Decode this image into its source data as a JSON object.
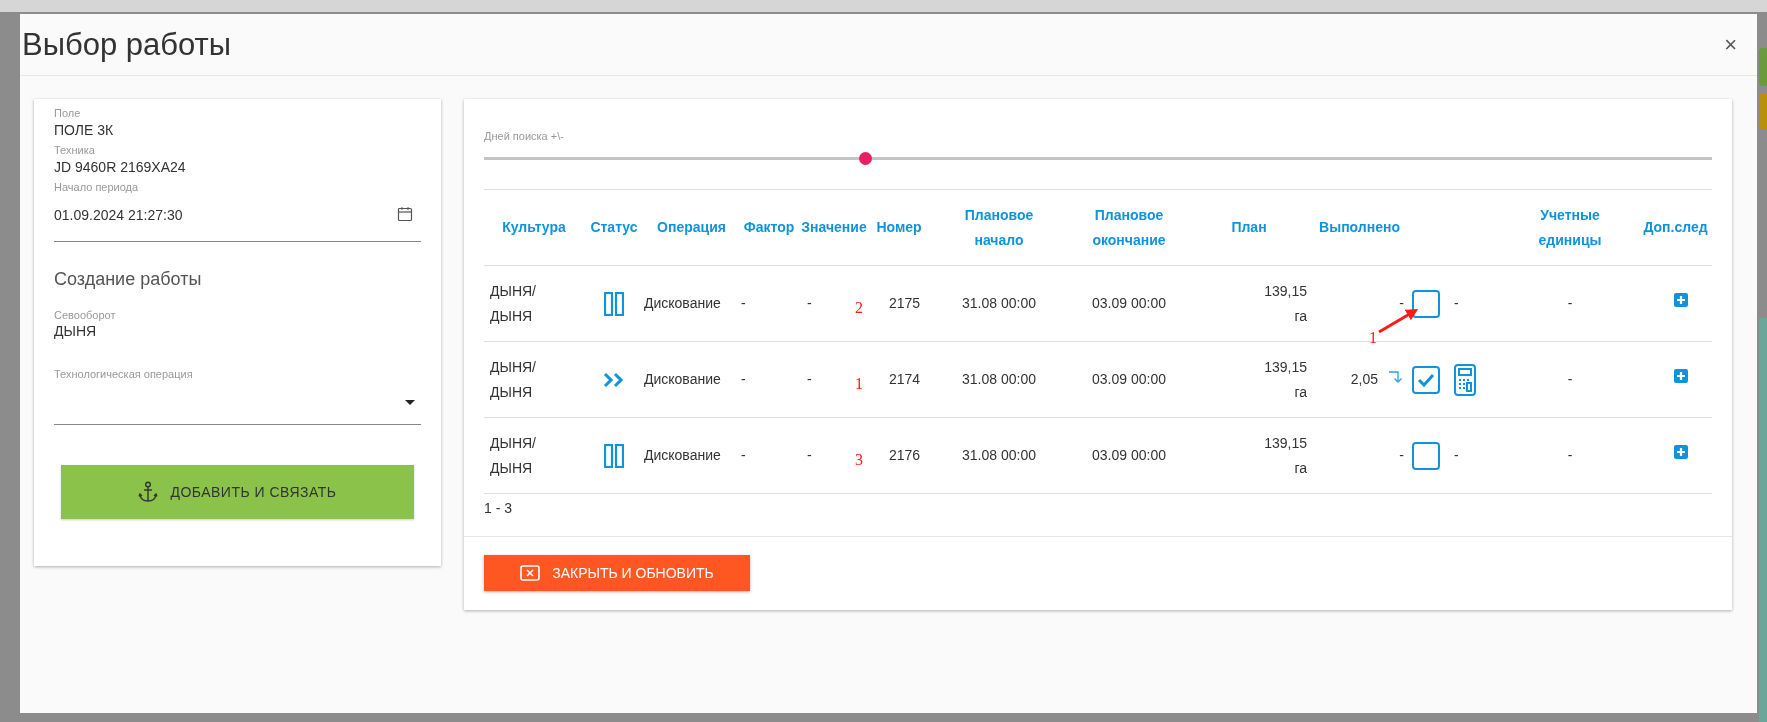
{
  "window": {
    "title": "Выбор работы",
    "close": "×"
  },
  "left_panel": {
    "fields": [
      {
        "label": "Поле",
        "value": "ПОЛЕ 3К"
      },
      {
        "label": "Техника",
        "value": "JD 9460R 2169ХА24"
      }
    ],
    "period": {
      "label": "Начало периода",
      "value": "01.09.2024 21:27:30"
    },
    "section_title": "Создание работы",
    "rotation": {
      "label": "Севооборот",
      "value": "ДЫНЯ"
    },
    "operation": {
      "label": "Технологическая операция"
    },
    "add_button": "ДОБАВИТЬ И СВЯЗАТЬ"
  },
  "slider": {
    "label": "Дней поиска +\\-",
    "level": 0.31
  },
  "table": {
    "columns": [
      "Культура",
      "Статус",
      "Операция",
      "Фактор",
      "Значение",
      "Номер",
      "Плановое начало",
      "Плановое окончание",
      "План",
      "Выполнено",
      "",
      "Учетные единицы",
      "Доп.след"
    ],
    "rows": [
      {
        "culture": "ДЫНЯ/ДЫНЯ",
        "kind": "paused",
        "operation": "Дискование",
        "factor": "-",
        "value": "-",
        "annotation": "2",
        "number": "2175",
        "start": "31.08 00:00",
        "end": "03.09 00:00",
        "plan": "139,15 га",
        "done": "-",
        "linked": false,
        "checked": false,
        "calculator": false,
        "done_extra": "-",
        "units": "-",
        "arrow_annotation": "1"
      },
      {
        "culture": "ДЫНЯ/ДЫНЯ",
        "kind": "running",
        "operation": "Дискование",
        "factor": "-",
        "value": "-",
        "annotation": "1",
        "number": "2174",
        "start": "31.08 00:00",
        "end": "03.09 00:00",
        "plan": "139,15 га",
        "done": "2,05",
        "linked": true,
        "checked": true,
        "calculator": true,
        "units": "-"
      },
      {
        "culture": "ДЫНЯ/ДЫНЯ",
        "kind": "paused",
        "operation": "Дискование",
        "factor": "-",
        "value": "-",
        "annotation": "3",
        "number": "2176",
        "start": "31.08 00:00",
        "end": "03.09 00:00",
        "plan": "139,15 га",
        "done": "-",
        "linked": false,
        "checked": false,
        "calculator": false,
        "done_extra": "-",
        "units": "-"
      }
    ],
    "pager": "1 - 3"
  },
  "close_button": "ЗАКРЫТЬ И ОБНОВИТЬ"
}
